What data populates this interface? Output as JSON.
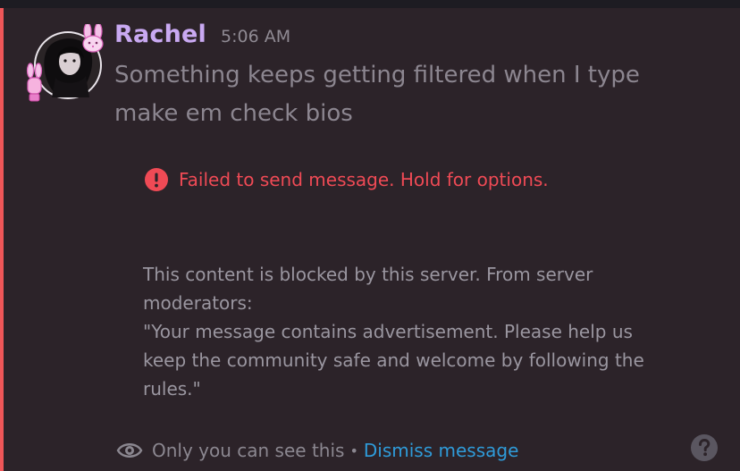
{
  "message": {
    "author": "Rachel",
    "timestamp": "5:06 AM",
    "text": "Something keeps getting filtered when I type make em check bios"
  },
  "error": {
    "icon": "exclamation-circle-icon",
    "text": "Failed to send message. Hold for options."
  },
  "moderation": {
    "intro": "This content is blocked by this server. From server moderators:",
    "quote": "\"Your message contains advertisement. Please help us keep the community safe and welcome by following the rules.\""
  },
  "footer": {
    "icon": "eye-icon",
    "visibility_text": "Only you can see this",
    "separator": "•",
    "dismiss_label": "Dismiss message",
    "help_icon": "question-circle-icon"
  },
  "colors": {
    "background": "#2c2329",
    "accent_bar": "#ee5658",
    "author_name": "#c9a9f2",
    "error": "#ef4a55",
    "link": "#2f9bd9"
  }
}
